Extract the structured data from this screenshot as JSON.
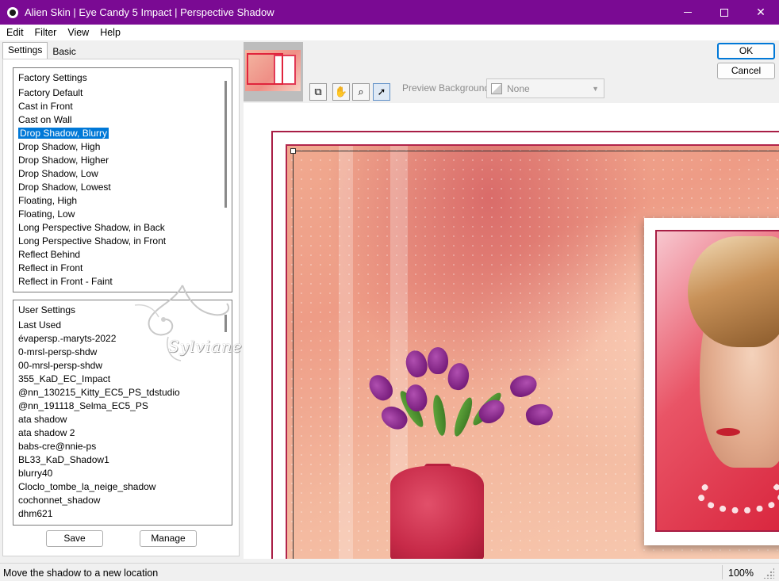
{
  "window": {
    "title": "Alien Skin | Eye Candy 5 Impact | Perspective Shadow",
    "icon": "alien-skin-icon"
  },
  "menu": [
    "Edit",
    "Filter",
    "View",
    "Help"
  ],
  "tabs": [
    "Settings",
    "Basic"
  ],
  "factory_settings": {
    "title": "Factory Settings",
    "selected": "Drop Shadow, Blurry",
    "items": [
      "Factory Default",
      "Cast in Front",
      "Cast on Wall",
      "Drop Shadow, Blurry",
      "Drop Shadow, High",
      "Drop Shadow, Higher",
      "Drop Shadow, Low",
      "Drop Shadow, Lowest",
      "Floating, High",
      "Floating, Low",
      "Long Perspective Shadow, in Back",
      "Long Perspective Shadow, in Front",
      "Reflect Behind",
      "Reflect in Front",
      "Reflect in Front - Faint"
    ]
  },
  "user_settings": {
    "title": "User Settings",
    "items": [
      "Last Used",
      "évapersp.-maryts-2022",
      "0-mrsl-persp-shdw",
      "00-mrsl-persp-shdw",
      "355_KaD_EC_Impact",
      "@nn_130215_Kitty_EC5_PS_tdstudio",
      "@nn_191118_Selma_EC5_PS",
      "ata shadow",
      "ata shadow 2",
      "babs-cre@nnie-ps",
      "BL33_KaD_Shadow1",
      "blurry40",
      "Cloclo_tombe_la_neige_shadow",
      "cochonnet_shadow",
      "dhm621"
    ]
  },
  "buttons": {
    "save": "Save",
    "manage": "Manage",
    "ok": "OK",
    "cancel": "Cancel"
  },
  "preview_background": {
    "label": "Preview Background:",
    "value": "None"
  },
  "tools": [
    "navigator-icon",
    "hand-icon",
    "zoom-icon",
    "pointer-icon"
  ],
  "watermark": "Sylviane",
  "status": {
    "text": "Move the shadow to a new location",
    "zoom": "100%"
  },
  "colors": {
    "titlebar": "#7a0a93",
    "selection": "#0078d7",
    "frame": "#a81e45"
  }
}
